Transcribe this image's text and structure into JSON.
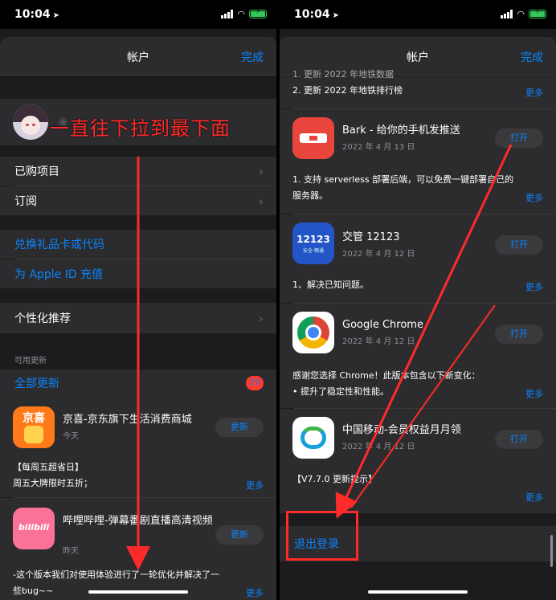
{
  "status_bar": {
    "time": "10:04",
    "battery": "⚡"
  },
  "left": {
    "nav": {
      "title": "帐户",
      "done": "完成"
    },
    "profile_name": "a",
    "rows": {
      "purchased": "已购项目",
      "subscriptions": "订阅",
      "redeem": "兑换礼品卡或代码",
      "topup": "为 Apple ID 充值",
      "personalized": "个性化推荐"
    },
    "updates_header": "可用更新",
    "update_all": "全部更新",
    "badge_count": "29",
    "apps": [
      {
        "name": "京喜-京东旗下生活消费商城",
        "date": "今天",
        "button": "更新",
        "notes": [
          "【每周五超省日】",
          "周五大牌限时五折；"
        ],
        "more": "更多",
        "icon_text": "京喜"
      },
      {
        "name": "哔哩哔哩-弹幕番剧直播高清视频",
        "date": "昨天",
        "button": "更新",
        "notes": [
          "-这个版本我们对使用体验进行了一轮优化并解决了一",
          "些bug~~"
        ],
        "more": "更多",
        "icon_text": "bilibili"
      }
    ],
    "annotation": "一直往下拉到最下面"
  },
  "right": {
    "nav": {
      "title": "帐户",
      "done": "完成"
    },
    "top_notes": [
      "1. 更新 2022 年地铁数据",
      "2. 更新 2022 年地铁排行榜"
    ],
    "top_more": "更多",
    "apps": [
      {
        "name": "Bark - 给你的手机发推送",
        "date": "2022 年 4 月 13 日",
        "button": "打开",
        "notes": [
          "1. 支持 serverless 部署后端，可以免费一键部署自己的",
          "服务器。"
        ],
        "more": "更多"
      },
      {
        "name": "交管 12123",
        "date": "2022 年 4 月 12 日",
        "button": "打开",
        "notes": [
          "1、解决已知问题。"
        ],
        "more": "更多",
        "icon_text": "12123",
        "icon_sub": "安全·畅通"
      },
      {
        "name": "Google Chrome",
        "date": "2022 年 4 月 12 日",
        "button": "打开",
        "notes": [
          "感谢您选择 Chrome！此版本包含以下新变化：",
          "• 提升了稳定性和性能。"
        ],
        "more": "更多"
      },
      {
        "name": "中国移动-会员权益月月领",
        "date": "2022 年 4 月 12 日",
        "button": "打开",
        "notes": [
          "【V7.7.0 更新提示】"
        ],
        "more": "更多"
      }
    ],
    "logout": "退出登录"
  },
  "colors": {
    "accent": "#0a84ff",
    "annotation": "#ff2a2a",
    "badge": "#ff3b30"
  }
}
